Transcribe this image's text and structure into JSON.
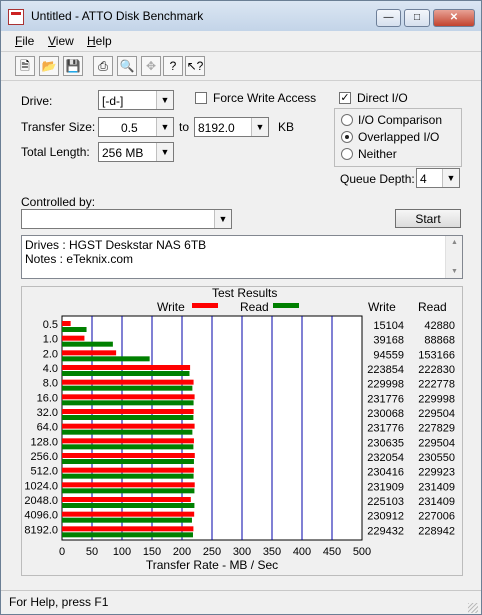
{
  "window": {
    "title": "Untitled - ATTO Disk Benchmark"
  },
  "menu": [
    {
      "label": "File",
      "accel": "F",
      "rest": "ile"
    },
    {
      "label": "View",
      "accel": "V",
      "rest": "iew"
    },
    {
      "label": "Help",
      "accel": "H",
      "rest": "elp"
    }
  ],
  "toolbar": {
    "icons": [
      "new-icon",
      "open-icon",
      "save-icon",
      "print-icon",
      "print-preview-icon",
      "move-icon",
      "help-icon",
      "context-help-icon"
    ]
  },
  "form": {
    "drive_label": "Drive:",
    "drive_value": "[-d-]",
    "force_write_label": "Force Write Access",
    "direct_io_label": "Direct I/O",
    "transfer_size_label": "Transfer Size:",
    "transfer_from": "0.5",
    "to_label": "to",
    "transfer_to": "8192.0",
    "kb_label": "KB",
    "total_length_label": "Total Length:",
    "total_length_value": "256 MB",
    "io_comparison_label": "I/O Comparison",
    "overlapped_io_label": "Overlapped I/O",
    "neither_label": "Neither",
    "queue_depth_label": "Queue Depth:",
    "queue_depth_value": "4",
    "controlled_by_label": "Controlled by:",
    "start_label": "Start",
    "notes_line1": "Drives : HGST Deskstar NAS 6TB",
    "notes_line2": "Notes : eTeknix.com"
  },
  "results": {
    "title": "Test Results",
    "write_legend": "Write",
    "read_legend": "Read",
    "write_col": "Write",
    "read_col": "Read"
  },
  "chart_data": {
    "type": "bar",
    "orientation": "horizontal",
    "xlabel": "Transfer Rate - MB / Sec",
    "xlim": [
      0,
      500
    ],
    "xticks": [
      "0",
      "50",
      "100",
      "150",
      "200",
      "250",
      "300",
      "350",
      "400",
      "450",
      "500"
    ],
    "categories": [
      "0.5",
      "1.0",
      "2.0",
      "4.0",
      "8.0",
      "16.0",
      "32.0",
      "64.0",
      "128.0",
      "256.0",
      "512.0",
      "1024.0",
      "2048.0",
      "4096.0",
      "8192.0"
    ],
    "series": [
      {
        "name": "Write",
        "color": "#ff0000",
        "values": [
          14.4,
          37.4,
          90.2,
          213.5,
          219.3,
          221.0,
          219.4,
          221.0,
          219.9,
          221.3,
          219.8,
          221.2,
          214.7,
          220.3,
          219.0
        ],
        "labels": [
          "15104",
          "39168",
          "94559",
          "223854",
          "229998",
          "231776",
          "230068",
          "231776",
          "230635",
          "232054",
          "230416",
          "231909",
          "225103",
          "230912",
          "229432"
        ]
      },
      {
        "name": "Read",
        "color": "#008000",
        "values": [
          40.9,
          84.8,
          146.1,
          212.5,
          217.3,
          219.3,
          219.0,
          217.3,
          219.0,
          219.9,
          219.3,
          220.7,
          220.7,
          216.6,
          218.3
        ],
        "labels": [
          "42880",
          "88868",
          "153166",
          "222830",
          "222778",
          "229998",
          "229504",
          "227829",
          "229504",
          "230550",
          "229923",
          "231409",
          "231409",
          "227006",
          "228942"
        ]
      }
    ],
    "grid": true
  },
  "status": {
    "text": "For Help, press F1"
  }
}
